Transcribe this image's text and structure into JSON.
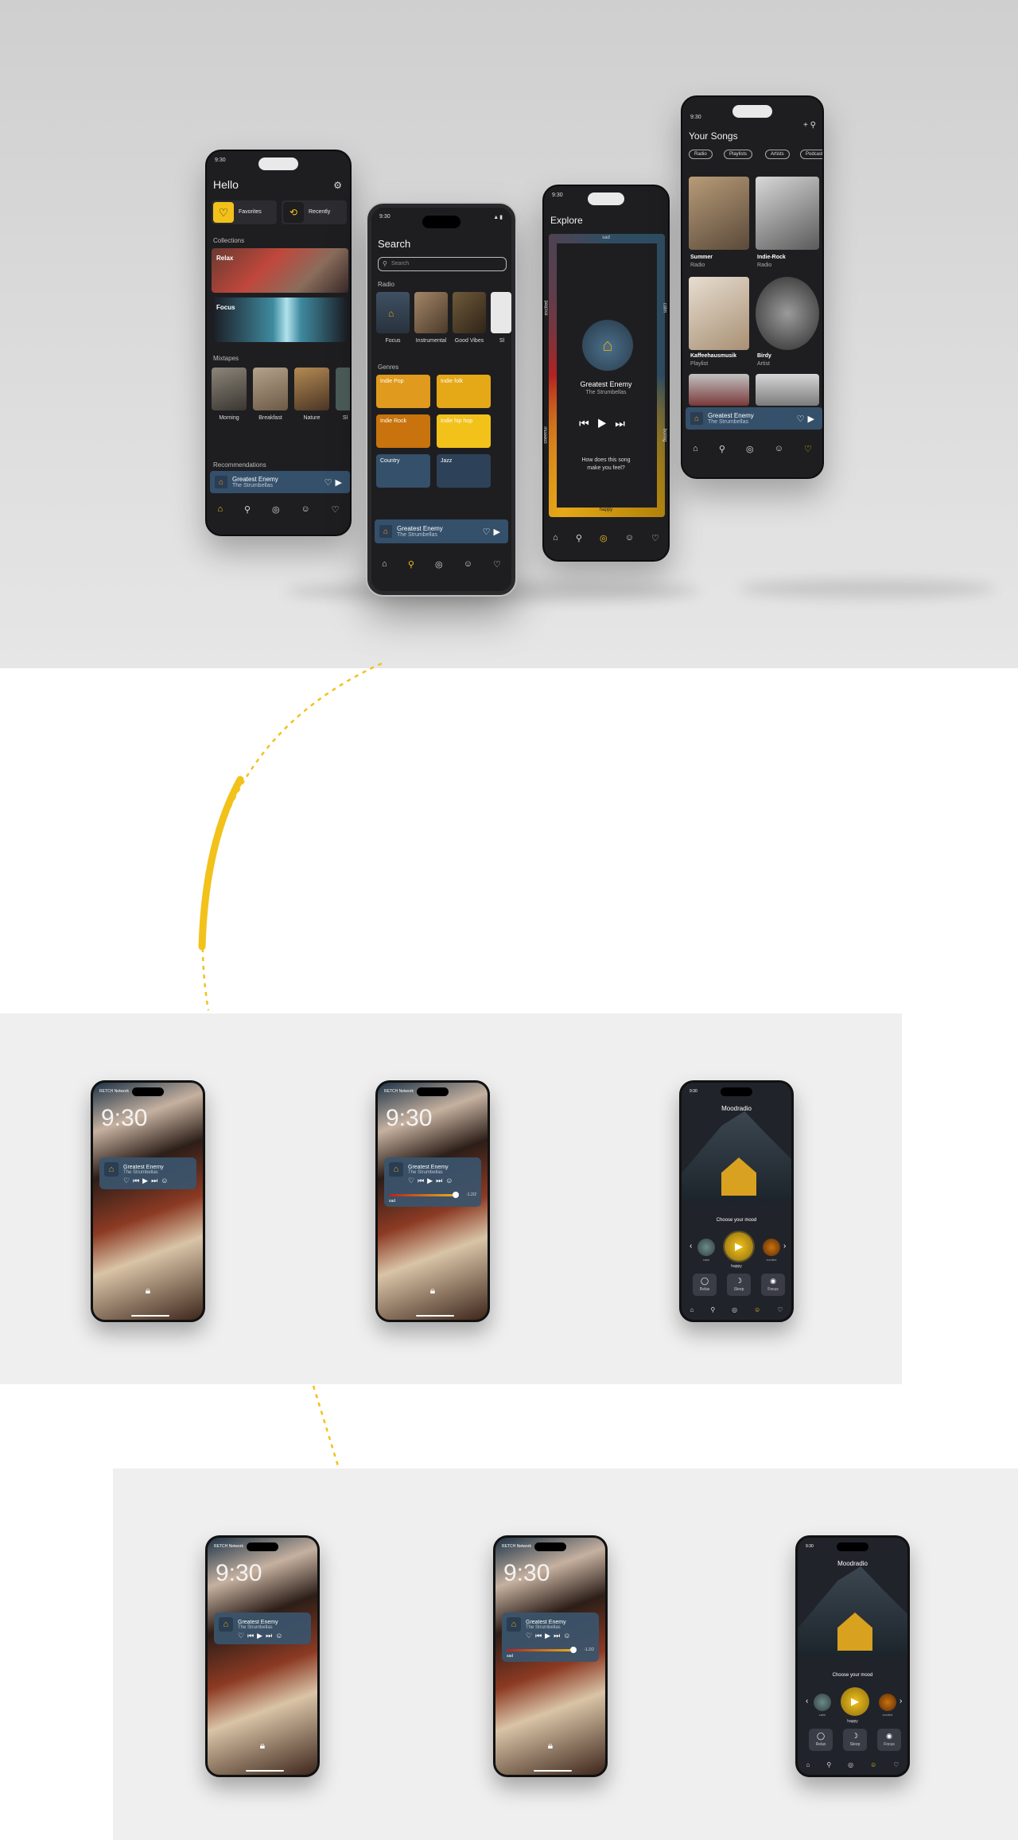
{
  "status_time": "9:30",
  "home": {
    "title": "Hello",
    "favorites": "Favorites",
    "recently": "Recently",
    "collections_label": "Collections",
    "collections": [
      "Relax",
      "Focus"
    ],
    "mixtapes_label": "Mixtapes",
    "mixtapes": [
      "Morning",
      "Breakfast",
      "Nature",
      "Sl"
    ],
    "recommendations_label": "Recommendations"
  },
  "search": {
    "title": "Search",
    "placeholder": "Search",
    "radio_label": "Radio",
    "radio": [
      "Focus",
      "Instrumental",
      "Good Vibes",
      "Sl"
    ],
    "genres_label": "Genres",
    "genres": [
      "Indie Pop",
      "Indie folk",
      "Indie Rock",
      "Indie hip hop",
      "Country",
      "Jazz"
    ]
  },
  "explore": {
    "title": "Explore",
    "top": "sad",
    "left": "excited",
    "right": "calm",
    "left_bottom": "cheerful",
    "right_bottom": "boring",
    "bottom": "happy",
    "question": "How does this song make you feel?"
  },
  "songs": {
    "title": "Your Songs",
    "filters": [
      "Radio",
      "Playlists",
      "Artists",
      "Podcasts"
    ],
    "items": [
      {
        "title": "Summer",
        "sub": "Radio"
      },
      {
        "title": "Indie-Rock",
        "sub": "Radio"
      },
      {
        "title": "Kaffeehausmusik",
        "sub": "Playlist"
      },
      {
        "title": "Birdy",
        "sub": "Artist"
      }
    ]
  },
  "now_playing": {
    "title": "Greatest Enemy",
    "artist": "The Strumbellas"
  },
  "lock": {
    "carrier": "RETCH Network",
    "time": "9:30",
    "mood": "sad",
    "mood_value": "-1.2/2"
  },
  "moodradio": {
    "title": "Moodradio",
    "choose": "Choose your mood",
    "current": "happy",
    "orbs": [
      "calm",
      "excited"
    ],
    "buttons": [
      "Relax",
      "Sleep",
      "Focus"
    ]
  },
  "colors": {
    "accent": "#f2c21b",
    "dark": "#1e1e21",
    "card": "#35506a",
    "orange": "#e5a817"
  }
}
